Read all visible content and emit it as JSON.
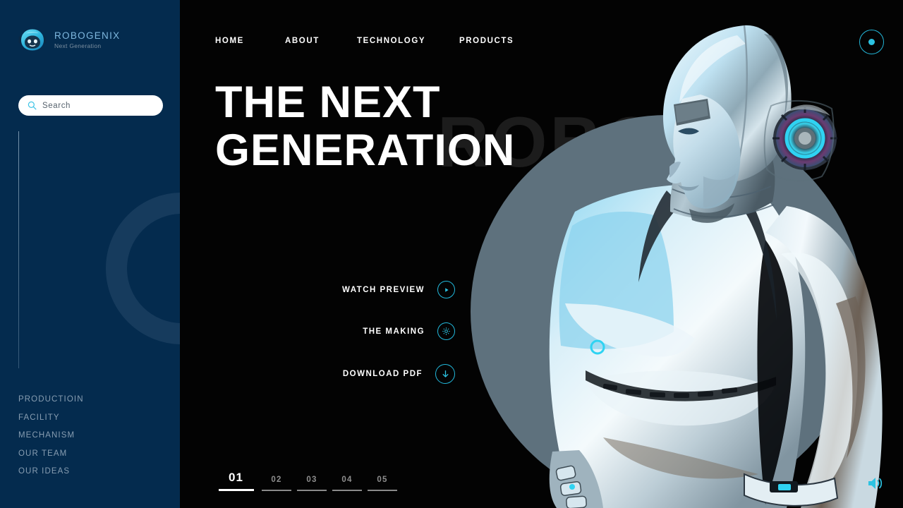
{
  "brand": {
    "name": "ROBOGENIX",
    "tagline": "Next Generation",
    "logo_icon": "robot-head-icon"
  },
  "search": {
    "placeholder": "Search",
    "value": "",
    "icon": "search-icon"
  },
  "sidebar": {
    "items": [
      {
        "label": "PRODUCTIOIN"
      },
      {
        "label": "FACILITY"
      },
      {
        "label": "MECHANISM"
      },
      {
        "label": "OUR TEAM"
      },
      {
        "label": "OUR IDEAS"
      }
    ]
  },
  "nav": {
    "items": [
      {
        "label": "HOME",
        "active": true
      },
      {
        "label": "ABOUT",
        "active": false
      },
      {
        "label": "TECHNOLOGY",
        "active": false
      },
      {
        "label": "PRODUCTS",
        "active": false
      }
    ],
    "dot_button_icon": "circle-dot-icon"
  },
  "hero": {
    "headline_line1": "THE NEXT",
    "headline_line2": "GENERATION",
    "watermark": "ROBOTICS",
    "image_alt": "chrome humanoid robot"
  },
  "actions": [
    {
      "label": "WATCH PREVIEW",
      "icon": "play-icon"
    },
    {
      "label": "THE MAKING",
      "icon": "gear-icon"
    },
    {
      "label": "DOWNLOAD PDF",
      "icon": "arrow-down-icon"
    }
  ],
  "pagination": {
    "items": [
      {
        "label": "01",
        "active": true
      },
      {
        "label": "02",
        "active": false
      },
      {
        "label": "03",
        "active": false
      },
      {
        "label": "04",
        "active": false
      },
      {
        "label": "05",
        "active": false
      }
    ]
  },
  "volume": {
    "icon": "volume-on-icon"
  },
  "colors": {
    "accent_cyan": "#2CC3E2",
    "sidebar_navy": "#042B4E",
    "background_black": "#030303",
    "brand_blue": "#7FB8DF",
    "circle_gray": "#5E717D",
    "watermark_gray": "#1C1C1C"
  }
}
